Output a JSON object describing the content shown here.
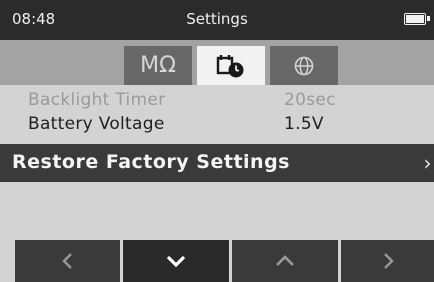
{
  "status_bar": {
    "time": "08:48",
    "title": "Settings"
  },
  "tabs": [
    {
      "label": "MΩ",
      "icon": "megohm-icon"
    },
    {
      "label": "",
      "icon": "settings-timer-icon"
    },
    {
      "label": "",
      "icon": "globe-icon"
    }
  ],
  "settings": {
    "backlight_timer": {
      "label": "Backlight Timer",
      "value": "20sec"
    },
    "battery_voltage": {
      "label": "Battery Voltage",
      "value": "1.5V"
    },
    "restore_factory": {
      "label": "Restore Factory Settings",
      "chevron": "›"
    }
  },
  "nav_buttons": [
    "left-arrow-icon",
    "down-arrow-icon",
    "up-arrow-icon",
    "right-arrow-icon"
  ],
  "colors": {
    "status_bar": "#2b2b2b",
    "active_tab": "#f2f2f2",
    "inactive_tab": "#686868",
    "highlight_row": "#3a3a3a"
  }
}
